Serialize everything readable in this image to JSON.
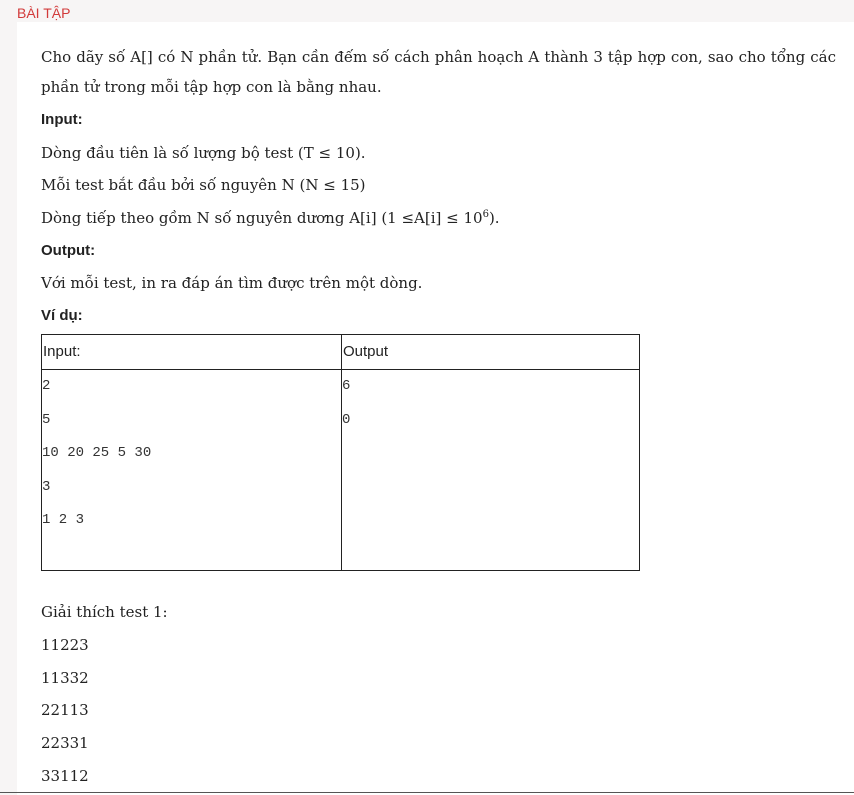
{
  "header": {
    "title": "BÀI TẬP"
  },
  "problem": {
    "statement": "Cho dãy số A[] có N phần tử. Bạn cần đếm số cách phân hoạch A thành 3 tập hợp con, sao cho tổng các phần tử trong mỗi tập hợp con là bằng nhau.",
    "input_heading": "Input:",
    "input_line_1": "Dòng đầu tiên là số lượng bộ test (T ≤ 10).",
    "input_line_2": "Mỗi test bắt đầu bởi số nguyên N (N ≤ 15)",
    "input_line_3_prefix": "Dòng tiếp theo gồm N số nguyên dương A[i] (1 ≤A[i] ≤ 10",
    "input_line_3_exponent": "6",
    "input_line_3_suffix": ").",
    "output_heading": "Output:",
    "output_line": "Với mỗi test, in ra đáp án tìm được trên một dòng.",
    "example_heading": "Ví dụ:"
  },
  "example_table": {
    "headers": {
      "input": "Input:",
      "output": "Output"
    },
    "input_lines": [
      "2",
      "5",
      "10 20 25 5 30",
      "3",
      "1 2 3"
    ],
    "output_lines": [
      "6",
      "0"
    ]
  },
  "explanation": {
    "title": "Giải thích test 1:",
    "lines": [
      "11223",
      "11332",
      "22113",
      "22331",
      "33112"
    ]
  }
}
